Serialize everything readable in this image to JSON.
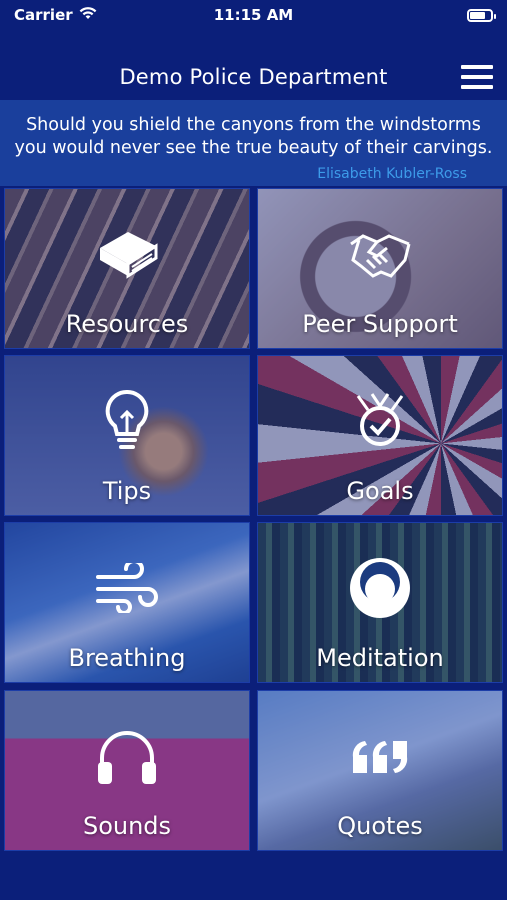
{
  "status_bar": {
    "carrier": "Carrier",
    "time": "11:15 AM",
    "wifi_icon": "wifi-icon",
    "battery_icon": "battery-icon"
  },
  "nav": {
    "title": "Demo Police Department",
    "menu_icon": "hamburger-menu-icon"
  },
  "quote": {
    "text": "Should you shield the canyons from the windstorms you would never see the true beauty of their carvings.",
    "author": "Elisabeth Kubler-Ross",
    "author_color": "#3d9be9"
  },
  "tiles": [
    {
      "label": "Resources",
      "icon": "book-icon"
    },
    {
      "label": "Peer Support",
      "icon": "handshake-icon"
    },
    {
      "label": "Tips",
      "icon": "lightbulb-icon"
    },
    {
      "label": "Goals",
      "icon": "target-check-icon"
    },
    {
      "label": "Breathing",
      "icon": "wind-icon"
    },
    {
      "label": "Meditation",
      "icon": "meditation-circle-icon"
    },
    {
      "label": "Sounds",
      "icon": "headphones-icon"
    },
    {
      "label": "Quotes",
      "icon": "quote-marks-icon"
    }
  ],
  "colors": {
    "background": "#0b1f7a",
    "banner": "#1a3f9c"
  }
}
